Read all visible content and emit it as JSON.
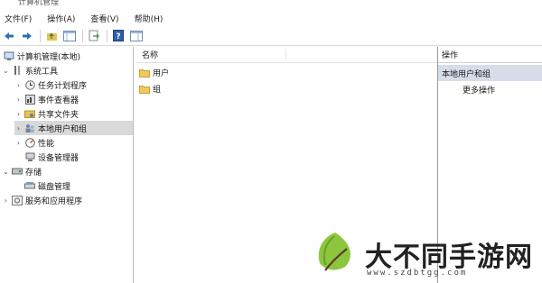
{
  "window": {
    "title": "计算机管理"
  },
  "menu": [
    "文件(F)",
    "操作(A)",
    "查看(V)",
    "帮助(H)"
  ],
  "toolbar_icons": [
    "back-arrow-icon",
    "forward-arrow-icon",
    "up-folder-icon",
    "console-tree-icon",
    "export-list-icon",
    "help-icon",
    "properties-icon"
  ],
  "tree": [
    {
      "label": "计算机管理(本地)",
      "icon": "computer-management-icon",
      "level": 0,
      "arrow": ""
    },
    {
      "label": "系统工具",
      "icon": "tools-icon",
      "level": 1,
      "arrow": "v"
    },
    {
      "label": "任务计划程序",
      "icon": "clock-icon",
      "level": 2,
      "arrow": ">"
    },
    {
      "label": "事件查看器",
      "icon": "event-viewer-icon",
      "level": 2,
      "arrow": ">"
    },
    {
      "label": "共享文件夹",
      "icon": "shared-folder-icon",
      "level": 2,
      "arrow": ">"
    },
    {
      "label": "本地用户和组",
      "icon": "users-icon",
      "level": 2,
      "arrow": ">",
      "selected": true
    },
    {
      "label": "性能",
      "icon": "performance-icon",
      "level": 2,
      "arrow": ">"
    },
    {
      "label": "设备管理器",
      "icon": "device-manager-icon",
      "level": 2,
      "arrow": ""
    },
    {
      "label": "存储",
      "icon": "storage-icon",
      "level": 1,
      "arrow": "v"
    },
    {
      "label": "磁盘管理",
      "icon": "disk-icon",
      "level": 2,
      "arrow": ""
    },
    {
      "label": "服务和应用程序",
      "icon": "services-icon",
      "level": 1,
      "arrow": ">"
    }
  ],
  "list": {
    "column_name": "名称",
    "items": [
      "用户",
      "组"
    ]
  },
  "actions": {
    "header": "操作",
    "section": "本地用户和组",
    "more": "更多操作"
  },
  "watermark": {
    "title": "大不同手游网",
    "url": "www.szdbtgg.com"
  }
}
